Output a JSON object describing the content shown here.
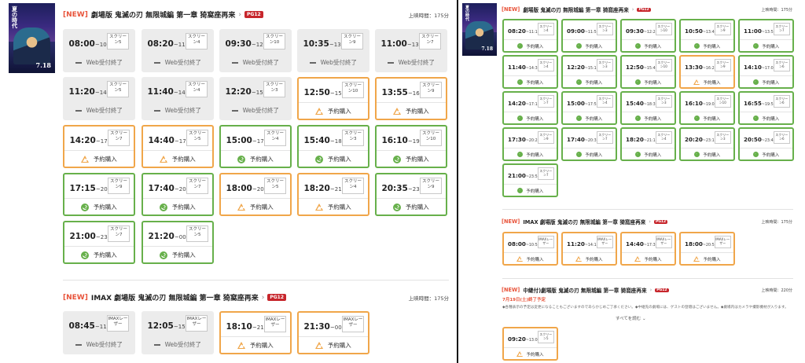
{
  "left_panel": {
    "poster": {
      "title": "夏の時代",
      "date": "7.18"
    },
    "sections": [
      {
        "new": "[NEW]",
        "title": "劇場版 鬼滅の刃 無限城編 第一章 猗窩座再来",
        "rating": "PG12",
        "runtime": "上映時間：175分",
        "showings": [
          {
            "start": "08:00",
            "end": "~10:55",
            "screen": "スクリーン5",
            "status": "Web受付終了",
            "state": "closed"
          },
          {
            "start": "08:20",
            "end": "~11:15",
            "screen": "スクリーン4",
            "status": "Web受付終了",
            "state": "closed"
          },
          {
            "start": "09:30",
            "end": "~12:25",
            "screen": "スクリーン10",
            "status": "Web受付終了",
            "state": "closed"
          },
          {
            "start": "10:35",
            "end": "~13:30",
            "screen": "スクリーン9",
            "status": "Web受付終了",
            "state": "closed"
          },
          {
            "start": "11:00",
            "end": "~13:55",
            "screen": "スクリーン7",
            "status": "Web受付終了",
            "state": "closed"
          },
          {
            "start": "11:20",
            "end": "~14:15",
            "screen": "スクリーン5",
            "status": "Web受付終了",
            "state": "closed"
          },
          {
            "start": "11:40",
            "end": "~14:35",
            "screen": "スクリーン4",
            "status": "Web受付終了",
            "state": "closed"
          },
          {
            "start": "12:20",
            "end": "~15:15",
            "screen": "スクリーン3",
            "status": "Web受付終了",
            "state": "closed"
          },
          {
            "start": "12:50",
            "end": "~15:45",
            "screen": "スクリーン10",
            "status": "予約購入",
            "state": "few"
          },
          {
            "start": "13:55",
            "end": "~16:50",
            "screen": "スクリーン9",
            "status": "予約購入",
            "state": "few"
          },
          {
            "start": "14:20",
            "end": "~17:15",
            "screen": "スクリーン7",
            "status": "予約購入",
            "state": "few"
          },
          {
            "start": "14:40",
            "end": "~17:35",
            "screen": "スクリーン5",
            "status": "予約購入",
            "state": "few"
          },
          {
            "start": "15:00",
            "end": "~17:55",
            "screen": "スクリーン4",
            "status": "予約購入",
            "state": "available"
          },
          {
            "start": "15:40",
            "end": "~18:35",
            "screen": "スクリーン3",
            "status": "予約購入",
            "state": "available"
          },
          {
            "start": "16:10",
            "end": "~19:05",
            "screen": "スクリーン10",
            "status": "予約購入",
            "state": "available"
          },
          {
            "start": "17:15",
            "end": "~20:10",
            "screen": "スクリーン9",
            "status": "予約購入",
            "state": "available"
          },
          {
            "start": "17:40",
            "end": "~20:35",
            "screen": "スクリーン7",
            "status": "予約購入",
            "state": "available"
          },
          {
            "start": "18:00",
            "end": "~20:55",
            "screen": "スクリーン5",
            "status": "予約購入",
            "state": "few"
          },
          {
            "start": "18:20",
            "end": "~21:15",
            "screen": "スクリーン4",
            "status": "予約購入",
            "state": "few"
          },
          {
            "start": "20:35",
            "end": "~23:30",
            "screen": "スクリーン9",
            "status": "予約購入",
            "state": "available"
          },
          {
            "start": "21:00",
            "end": "~23:55",
            "screen": "スクリーン7",
            "status": "予約購入",
            "state": "available"
          },
          {
            "start": "21:20",
            "end": "~00:15",
            "screen": "スクリーン5",
            "status": "予約購入",
            "state": "available"
          }
        ]
      },
      {
        "new": "[NEW]",
        "title": "IMAX 劇場版 鬼滅の刃 無限城編 第一章 猗窩座再来",
        "rating": "PG12",
        "runtime": "上映時間：175分",
        "showings": [
          {
            "start": "08:45",
            "end": "~11:40",
            "screen": "IMAXレーザー",
            "status": "Web受付終了",
            "state": "closed"
          },
          {
            "start": "12:05",
            "end": "~15:00",
            "screen": "IMAXレーザー",
            "status": "Web受付終了",
            "state": "closed"
          },
          {
            "start": "18:10",
            "end": "~21:05",
            "screen": "IMAXレーザー",
            "status": "予約購入",
            "state": "few"
          },
          {
            "start": "21:30",
            "end": "~00:25",
            "screen": "IMAXレーザー",
            "status": "予約購入",
            "state": "few"
          }
        ]
      }
    ]
  },
  "right_panel": {
    "poster": {
      "title": "夏の時代",
      "date": "7.18"
    },
    "sections": [
      {
        "new": "[NEW]",
        "title": "劇場版 鬼滅の刃 無限城編 第一章 猗窩座再来",
        "rating": "PG12",
        "runtime": "上映時間：175分",
        "showings": [
          {
            "start": "08:20",
            "end": "~11:15",
            "screen": "スクリーン4",
            "status": "予約購入",
            "state": "available"
          },
          {
            "start": "09:00",
            "end": "~11:55",
            "screen": "スクリーン3",
            "status": "予約購入",
            "state": "available"
          },
          {
            "start": "09:30",
            "end": "~12:25",
            "screen": "スクリーン10",
            "status": "予約購入",
            "state": "available"
          },
          {
            "start": "10:50",
            "end": "~13:45",
            "screen": "スクリーン9",
            "status": "予約購入",
            "state": "available"
          },
          {
            "start": "11:00",
            "end": "~13:55",
            "screen": "スクリーン7",
            "status": "予約購入",
            "state": "available"
          },
          {
            "start": "11:40",
            "end": "~14:35",
            "screen": "スクリーン4",
            "status": "予約購入",
            "state": "available"
          },
          {
            "start": "12:20",
            "end": "~15:15",
            "screen": "スクリーン3",
            "status": "予約購入",
            "state": "available"
          },
          {
            "start": "12:50",
            "end": "~15:45",
            "screen": "スクリーン10",
            "status": "予約購入",
            "state": "available"
          },
          {
            "start": "13:30",
            "end": "~16:25",
            "screen": "スクリーン9",
            "status": "予約購入",
            "state": "few"
          },
          {
            "start": "14:10",
            "end": "~17:05",
            "screen": "スクリーン6",
            "status": "予約購入",
            "state": "available"
          },
          {
            "start": "14:20",
            "end": "~17:15",
            "screen": "スクリーン7",
            "status": "予約購入",
            "state": "available"
          },
          {
            "start": "15:00",
            "end": "~17:55",
            "screen": "スクリーン4",
            "status": "予約購入",
            "state": "available"
          },
          {
            "start": "15:40",
            "end": "~18:35",
            "screen": "スクリーン3",
            "status": "予約購入",
            "state": "available"
          },
          {
            "start": "16:10",
            "end": "~19:05",
            "screen": "スクリーン10",
            "status": "予約購入",
            "state": "available"
          },
          {
            "start": "16:55",
            "end": "~19:50",
            "screen": "スクリーン6",
            "status": "予約購入",
            "state": "available"
          },
          {
            "start": "17:30",
            "end": "~20:25",
            "screen": "スクリーン9",
            "status": "予約購入",
            "state": "available"
          },
          {
            "start": "17:40",
            "end": "~20:35",
            "screen": "スクリーン7",
            "status": "予約購入",
            "state": "available"
          },
          {
            "start": "18:20",
            "end": "~21:15",
            "screen": "スクリーン4",
            "status": "予約購入",
            "state": "available"
          },
          {
            "start": "20:20",
            "end": "~23:15",
            "screen": "スクリーン3",
            "status": "予約購入",
            "state": "available"
          },
          {
            "start": "20:50",
            "end": "~23:45",
            "screen": "スクリーン6",
            "status": "予約購入",
            "state": "available"
          },
          {
            "start": "21:00",
            "end": "~23:55",
            "screen": "スクリーン7",
            "status": "予約購入",
            "state": "available"
          }
        ]
      },
      {
        "new": "[NEW]",
        "title": "IMAX 劇場版 鬼滅の刃 無限城編 第一章 猗窩座再来",
        "rating": "PG12",
        "runtime": "上映時間：175分",
        "showings": [
          {
            "start": "08:00",
            "end": "~10:55",
            "screen": "IMAXレーザー",
            "status": "予約購入",
            "state": "few"
          },
          {
            "start": "11:20",
            "end": "~14:15",
            "screen": "IMAXレーザー",
            "status": "予約購入",
            "state": "few"
          },
          {
            "start": "14:40",
            "end": "~17:35",
            "screen": "IMAXレーザー",
            "status": "予約購入",
            "state": "few"
          },
          {
            "start": "18:00",
            "end": "~20:55",
            "screen": "IMAXレーザー",
            "status": "予約購入",
            "state": "few"
          }
        ]
      },
      {
        "new": "[NEW]",
        "title": "中継付)劇場版 鬼滅の刃 無限城編 第一章 猗窩座再来",
        "rating": "PG12",
        "runtime": "上映時間：220分",
        "note_date": "7月19日(土)終了予定",
        "note_text": "◆各種表示の予定は変更になることもございますのであらかじめご了承ください。◆中継先の劇場には、ゲストの登壇はございません。◆劇場内はカメラや撮影機材が入ります。",
        "more": "すべてを読む ⌄",
        "showings": [
          {
            "start": "09:20",
            "end": "~13:00",
            "screen": "スクリーン5",
            "status": "予約購入",
            "state": "few"
          }
        ]
      }
    ]
  },
  "icons": {
    "closed": "dash-icon",
    "few": "triangle-icon",
    "available": "double-circle-icon"
  },
  "colors": {
    "new": "#e8533a",
    "rating_bg": "#c7262c",
    "available": "#67b04b",
    "few": "#f0a64a",
    "closed_bg": "#ececec"
  }
}
